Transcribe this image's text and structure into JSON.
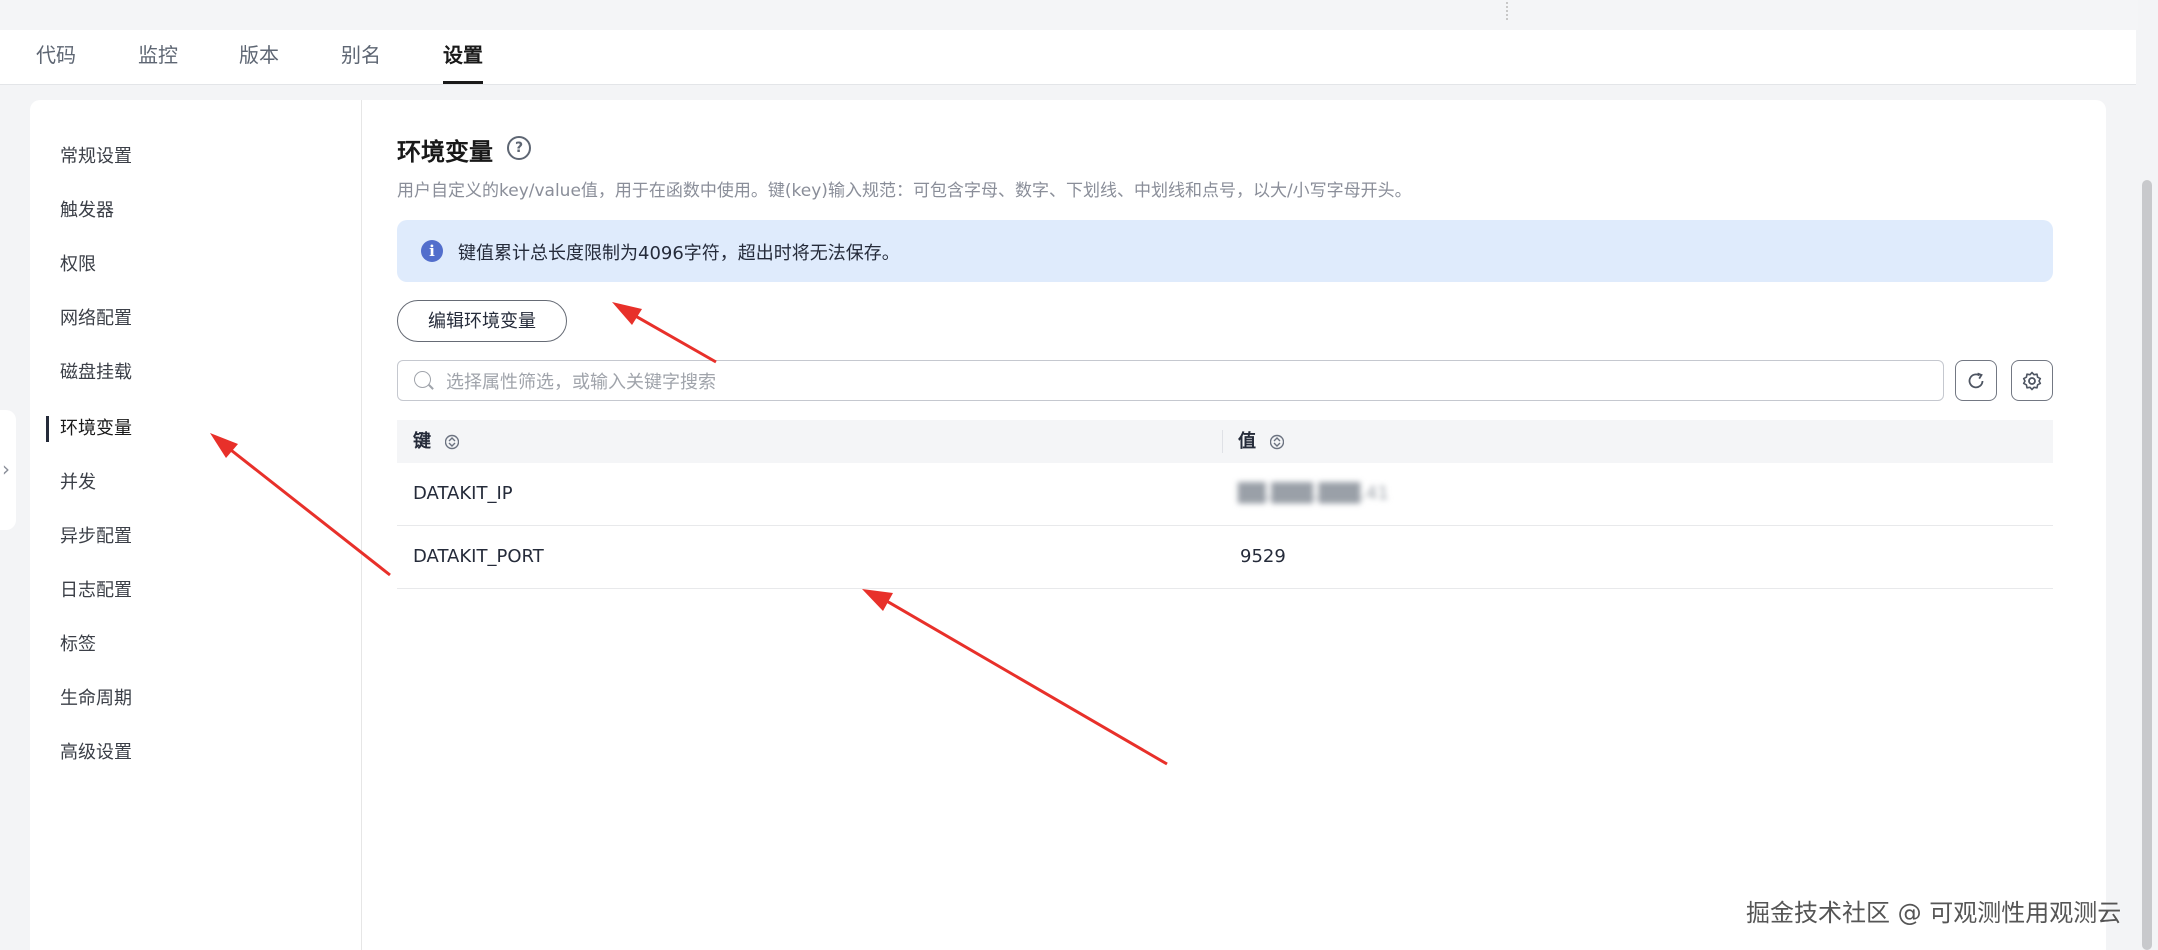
{
  "tabs": [
    {
      "label": "代码",
      "active": false
    },
    {
      "label": "监控",
      "active": false
    },
    {
      "label": "版本",
      "active": false
    },
    {
      "label": "别名",
      "active": false
    },
    {
      "label": "设置",
      "active": true
    }
  ],
  "sidebar": {
    "items": [
      {
        "label": "常规设置"
      },
      {
        "label": "触发器"
      },
      {
        "label": "权限"
      },
      {
        "label": "网络配置"
      },
      {
        "label": "磁盘挂载"
      },
      {
        "label": "环境变量",
        "active": true
      },
      {
        "label": "并发"
      },
      {
        "label": "异步配置"
      },
      {
        "label": "日志配置"
      },
      {
        "label": "标签"
      },
      {
        "label": "生命周期"
      },
      {
        "label": "高级设置"
      }
    ]
  },
  "main": {
    "title": "环境变量",
    "help_icon": "question-circle-icon",
    "description": "用户自定义的key/value值，用于在函数中使用。键(key)输入规范：可包含字母、数字、下划线、中划线和点号，以大/小写字母开头。",
    "alert": {
      "icon": "info-icon",
      "text": "键值累计总长度限制为4096字符，超出时将无法保存。"
    },
    "edit_button": "编辑环境变量",
    "search": {
      "placeholder": "选择属性筛选，或输入关键字搜索",
      "value": ""
    },
    "table": {
      "columns": [
        {
          "label": "键"
        },
        {
          "label": "值"
        }
      ],
      "rows": [
        {
          "key": "DATAKIT_IP",
          "value": "██.███.███.41"
        },
        {
          "key": "DATAKIT_PORT",
          "value": "9529"
        }
      ]
    }
  },
  "watermark": "掘金技术社区 @ 可观测性用观测云",
  "colors": {
    "accent_arrow": "#e8302a",
    "alert_bg": "#dfebfc",
    "info_icon": "#526ecc"
  }
}
